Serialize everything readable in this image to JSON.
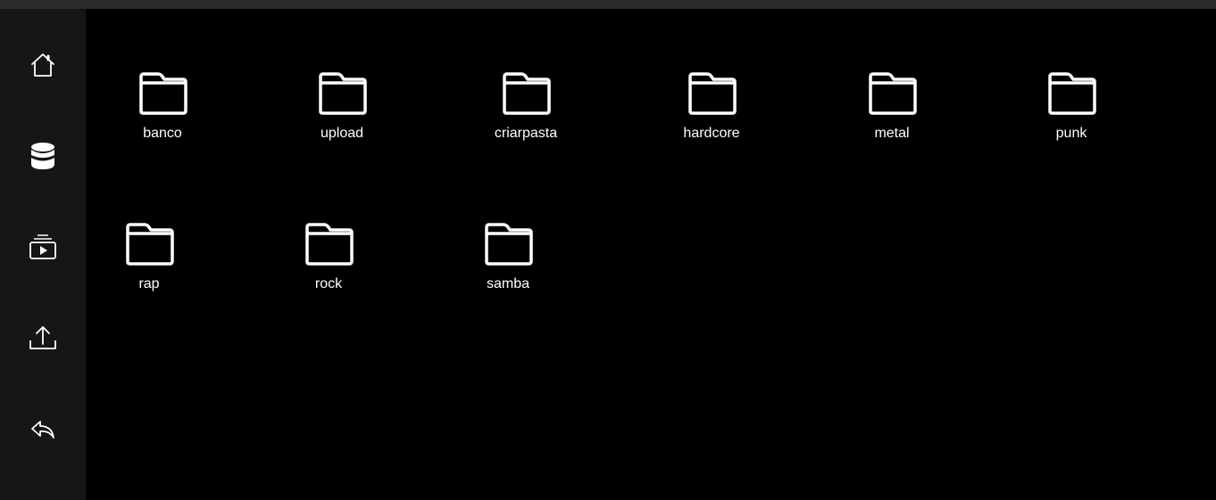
{
  "theme": {
    "background": "#000000",
    "sidebar": "#161616",
    "topbar": "#2b2b2b",
    "foreground": "#ffffff"
  },
  "sidebar": {
    "items": [
      {
        "icon": "home-icon"
      },
      {
        "icon": "database-icon"
      },
      {
        "icon": "media-library-icon"
      },
      {
        "icon": "upload-icon"
      },
      {
        "icon": "back-reply-icon"
      }
    ]
  },
  "folders": [
    {
      "label": "banco",
      "icon": "folder-icon"
    },
    {
      "label": "upload",
      "icon": "folder-icon"
    },
    {
      "label": "criarpasta",
      "icon": "folder-icon"
    },
    {
      "label": "hardcore",
      "icon": "folder-icon"
    },
    {
      "label": "metal",
      "icon": "folder-icon"
    },
    {
      "label": "punk",
      "icon": "folder-icon"
    },
    {
      "label": "rap",
      "icon": "folder-icon"
    },
    {
      "label": "rock",
      "icon": "folder-icon"
    },
    {
      "label": "samba",
      "icon": "folder-icon"
    }
  ]
}
